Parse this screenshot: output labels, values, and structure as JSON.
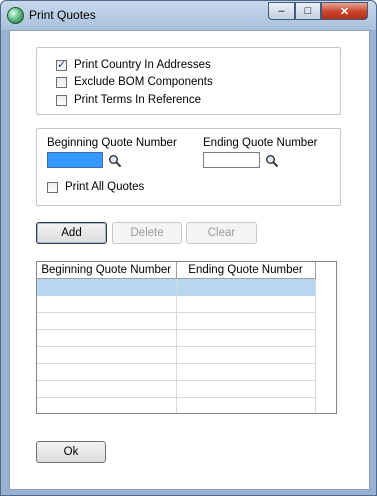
{
  "window": {
    "title": "Print Quotes",
    "controls": {
      "minimize": "–",
      "maximize": "□",
      "close": "✕"
    }
  },
  "options": {
    "print_country": {
      "label": "Print Country In Addresses",
      "checked": true
    },
    "exclude_bom": {
      "label": "Exclude BOM Components",
      "checked": false
    },
    "print_terms": {
      "label": "Print Terms In Reference",
      "checked": false
    }
  },
  "range": {
    "beginning_label": "Beginning Quote Number",
    "beginning_value": "",
    "ending_label": "Ending Quote Number",
    "ending_value": "",
    "print_all": {
      "label": "Print All Quotes",
      "checked": false
    }
  },
  "buttons": {
    "add": "Add",
    "delete": "Delete",
    "clear": "Clear",
    "ok": "Ok"
  },
  "grid": {
    "columns": [
      "Beginning Quote Number",
      "Ending Quote Number"
    ],
    "selected_row": 0
  },
  "colors": {
    "focused_input": "#3399ff",
    "selected_row": "#b7d8f0",
    "close_button": "#c7432a"
  },
  "icons": {
    "app": "green-orb-icon",
    "lookup": "magnifier-icon"
  }
}
